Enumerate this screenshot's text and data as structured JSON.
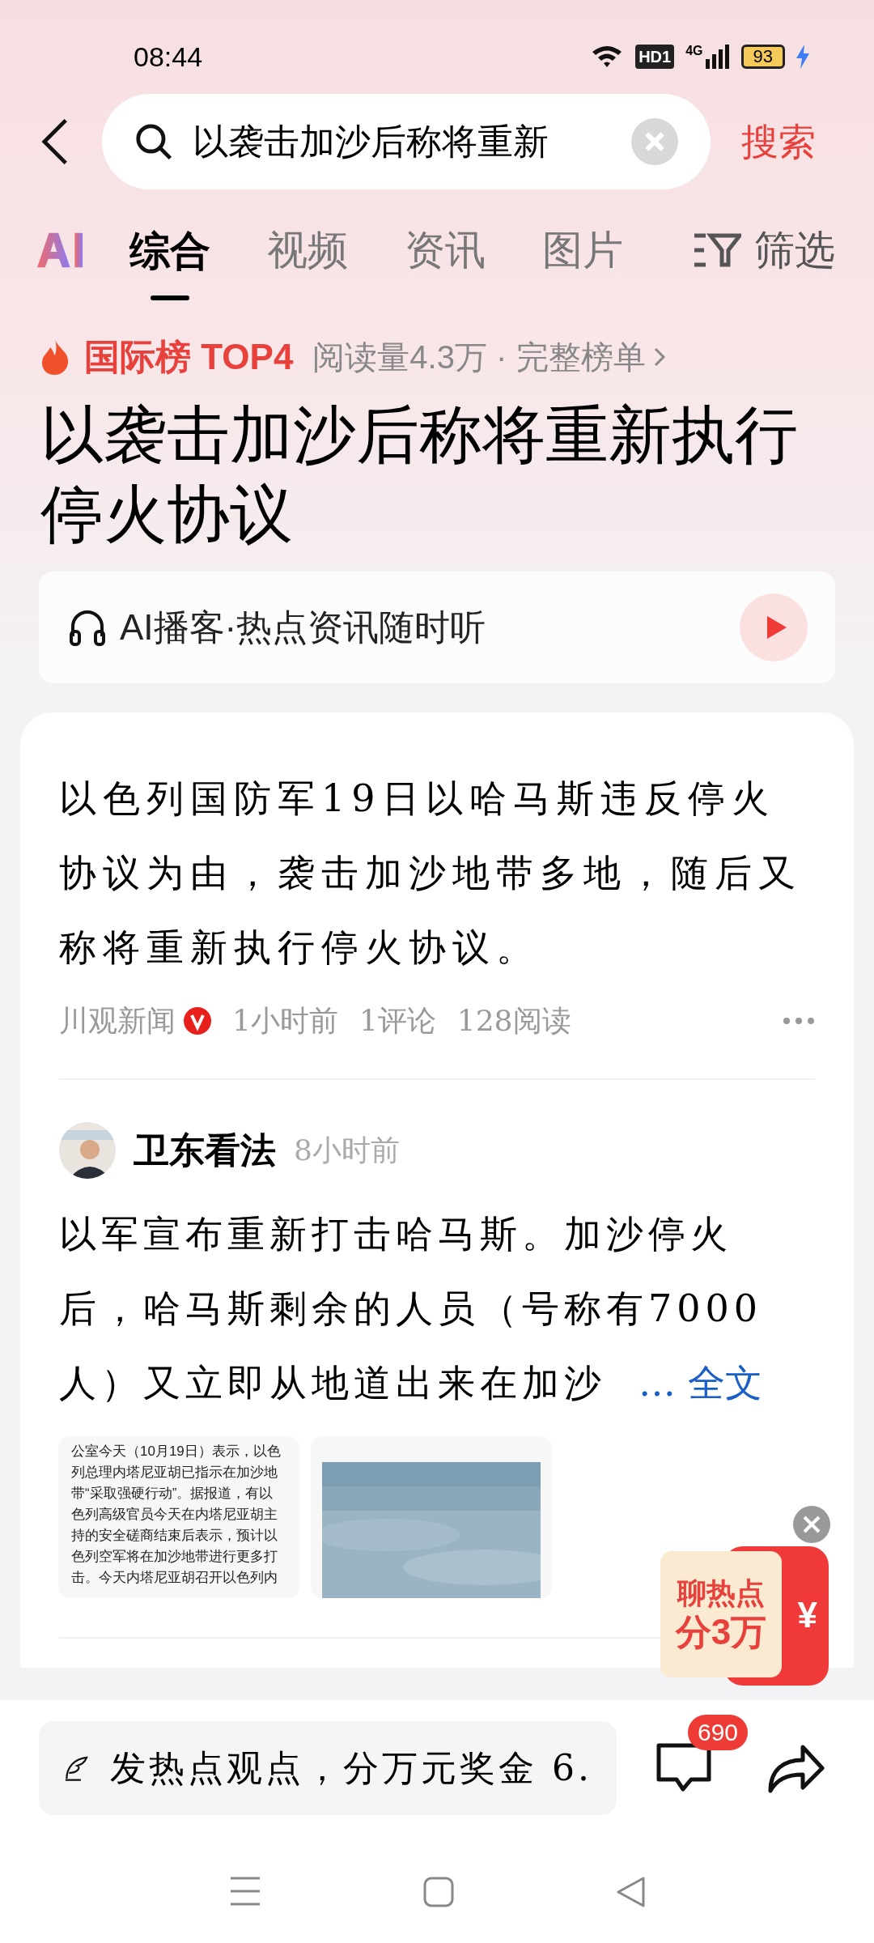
{
  "status_bar": {
    "time": "08:44",
    "network": "HD1",
    "signal_label": "4G",
    "battery": "93"
  },
  "search": {
    "value": "以袭击加沙后称将重新",
    "action": "搜索"
  },
  "tabs": [
    {
      "label": "综合",
      "selected": true
    },
    {
      "label": "视频",
      "selected": false
    },
    {
      "label": "资讯",
      "selected": false
    },
    {
      "label": "图片",
      "selected": false
    }
  ],
  "filter": "筛选",
  "ranking": {
    "board": "国际榜 TOP4",
    "reads": "阅读量4.3万 · 完整榜单"
  },
  "headline": "以袭击加沙后称将重新执行停火协议",
  "podcast": {
    "label": "AI播客·热点资讯随时听"
  },
  "summary": {
    "text": "以色列国防军19日以哈马斯违反停火协议为由，袭击加沙地带多地，随后又称将重新执行停火协议。",
    "source": "川观新闻",
    "verified": true,
    "time": "1小时前",
    "comments": "1评论",
    "reads": "128阅读"
  },
  "post": {
    "author": "卫东看法",
    "time": "8小时前",
    "text": "以军宣布重新打击哈马斯。加沙停火后，哈马斯剩余的人员（号称有7000人）又立即从地道出来在加沙",
    "more": "… 全文",
    "images": [
      {
        "kind": "document",
        "lines": [
          "公室今天（10月19日）表示，以色",
          "列总理内塔尼亚胡已指示在加沙地",
          "带“采取强硬行动”。据报道，有以",
          "色列高级官员今天在内塔尼亚胡主",
          "持的安全磋商结束后表示，预计以",
          "色列空军将在加沙地带进行更多打",
          "击。今天内塔尼亚胡召开以色列内"
        ]
      },
      {
        "kind": "picture"
      }
    ]
  },
  "promo": {
    "line_1": "聊热点",
    "line_2": "分3万",
    "symbol": "¥"
  },
  "bottom_bar": {
    "placeholder": "发热点观点，分万元奖金 6.",
    "comment_count": "690"
  }
}
